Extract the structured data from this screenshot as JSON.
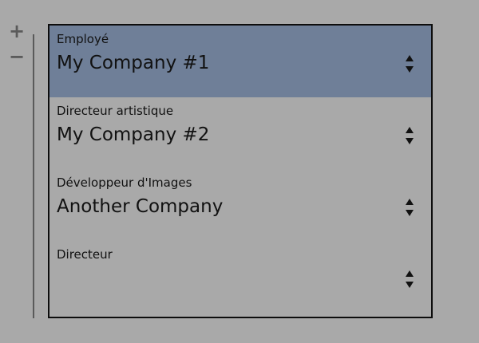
{
  "controls": {
    "add_label": "+",
    "remove_label": "−"
  },
  "colors": {
    "background": "#a9a9a9",
    "selected_row": "#6f7f98",
    "border": "#0d0d0d",
    "control": "#5a5a5a"
  },
  "rows": [
    {
      "label": "Employé",
      "value": "My Company #1",
      "selected": true
    },
    {
      "label": "Directeur artistique",
      "value": "My Company #2",
      "selected": false
    },
    {
      "label": "Développeur d'Images",
      "value": "Another Company",
      "selected": false
    },
    {
      "label": "Directeur",
      "value": "",
      "selected": false
    }
  ],
  "icons": {
    "stepper": "up-down-arrows-icon"
  }
}
